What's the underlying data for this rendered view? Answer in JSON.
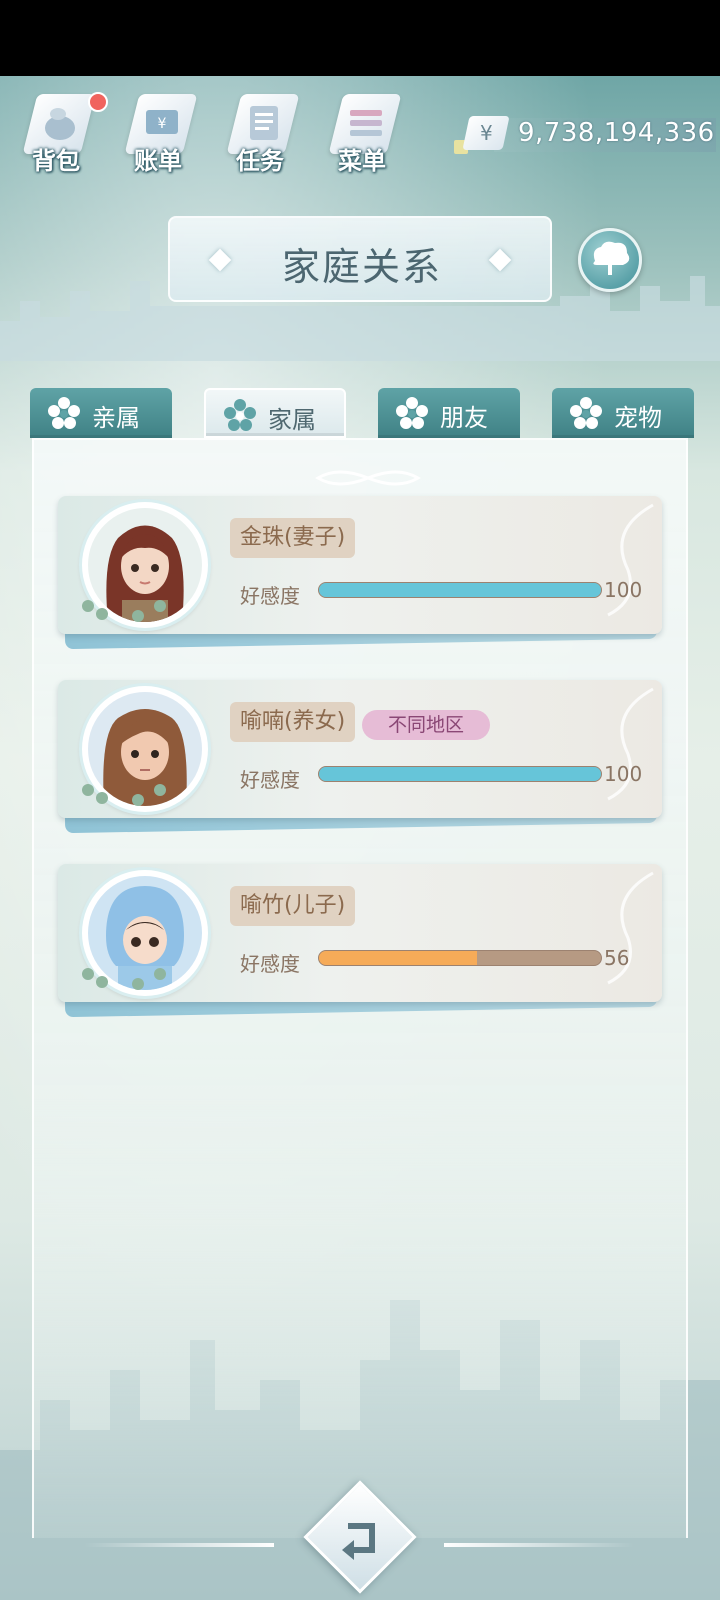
{
  "topnav": [
    {
      "id": "bag",
      "label": "背包",
      "icon": "bag-icon",
      "badge": true
    },
    {
      "id": "bill",
      "label": "账单",
      "icon": "bill-icon",
      "badge": false
    },
    {
      "id": "task",
      "label": "任务",
      "icon": "task-icon",
      "badge": false
    },
    {
      "id": "menu",
      "label": "菜单",
      "icon": "menu-icon",
      "badge": false
    }
  ],
  "currency": {
    "symbol": "¥",
    "value": "9,738,194,336"
  },
  "title": "家庭关系",
  "tabs": [
    {
      "label": "亲属",
      "icon": "flower-icon",
      "active": false
    },
    {
      "label": "家属",
      "icon": "flower-icon",
      "active": true
    },
    {
      "label": "朋友",
      "icon": "flower-icon",
      "active": false
    },
    {
      "label": "宠物",
      "icon": "flower-icon",
      "active": false
    }
  ],
  "affection_label": "好感度",
  "members": [
    {
      "name": "金珠(妻子)",
      "tag": "",
      "affection": 100,
      "affection_text": "100",
      "affection_max": 100,
      "hair": "#7a3528",
      "skin": "#f3d7c5",
      "bg": "#e9f1ef",
      "bar_color": "#66c5d9"
    },
    {
      "name": "喻喃(养女)",
      "tag": "不同地区",
      "affection": 100,
      "affection_text": "100",
      "affection_max": 100,
      "hair": "#8f5a3a",
      "skin": "#f1c9b0",
      "bg": "#dde9f2",
      "bar_color": "#66c5d9"
    },
    {
      "name": "喻竹(儿子)",
      "tag": "",
      "affection": 56,
      "affection_text": "56",
      "affection_max": 100,
      "hair": "#3a2a22",
      "skin": "#f6dccb",
      "bg": "#cfe4f3",
      "bar_color": "#f6ab58"
    }
  ],
  "colors": {
    "tab_inactive": "#4f9196",
    "panel": "#eef5f3",
    "name_pill": "#e0d2c2",
    "region_pill": "#e6bcd6"
  }
}
